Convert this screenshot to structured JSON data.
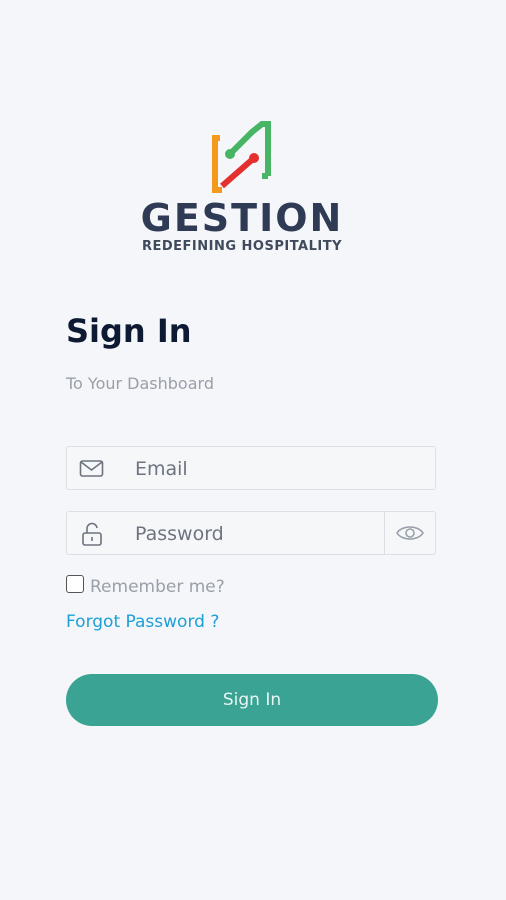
{
  "brand": {
    "name": "GESTION",
    "tagline": "REDEFINING HOSPITALITY"
  },
  "form": {
    "title": "Sign In",
    "subtitle": "To Your Dashboard",
    "email": {
      "placeholder": "Email",
      "value": "",
      "icon": "envelope-icon"
    },
    "password": {
      "placeholder": "Password",
      "value": "",
      "icon": "lock-icon",
      "toggle_icon": "eye-icon"
    },
    "remember_label": "Remember me?",
    "remember_checked": false,
    "forgot_label": "Forgot Password ?",
    "submit_label": "Sign In"
  },
  "colors": {
    "background": "#f4f6f9",
    "primary": "#3aa393",
    "link": "#1da0d6",
    "title": "#0e1a33",
    "brand_text": "#2f3b54",
    "logo_orange": "#f39a1e",
    "logo_green": "#47b563",
    "logo_red": "#e3302f"
  }
}
